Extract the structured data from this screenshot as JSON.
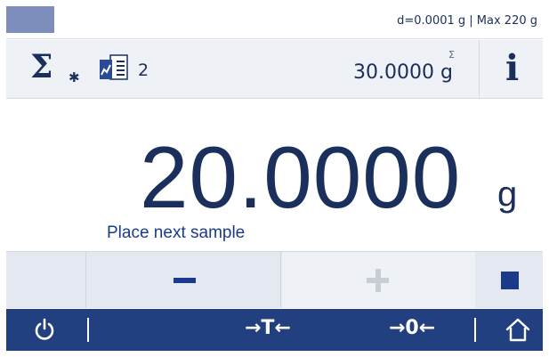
{
  "status_bar": {
    "readability": "d=0.0001 g | Max 220 g"
  },
  "info_row": {
    "statistics_icon": "sigma-gear-icon",
    "sample_count": "2",
    "sum_symbol": "Σ",
    "sum_value": "30.0000 g",
    "info_label": "i"
  },
  "main": {
    "weight_value": "20.0000",
    "weight_unit": "g",
    "prompt": "Place next sample"
  },
  "controls": {
    "minus_icon": "minus-icon",
    "plus_icon": "plus-icon",
    "stop_icon": "stop-icon",
    "plus_enabled": false
  },
  "bottom_bar": {
    "tare_label": "→T←",
    "zero_label": "→0←",
    "power_icon": "power-icon",
    "home_icon": "home-icon"
  },
  "colors": {
    "accent_dark": "#22407f",
    "text_primary": "#1a2f5c",
    "status_tab": "#7d8ebc",
    "control_bg": "#e4e9f1"
  }
}
